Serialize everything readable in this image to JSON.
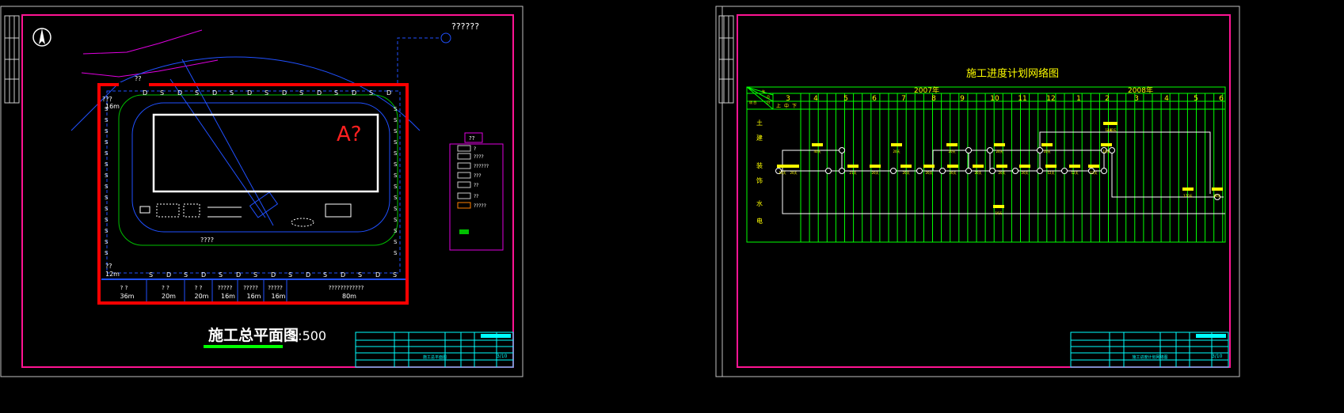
{
  "colors": {
    "background": "#000000",
    "sheet_border": "#c0c0c0",
    "frame": "#ff1493",
    "site_boundary": "#ff0000",
    "grid": "#00ff00",
    "label": "#ffff00",
    "water": "#0040ff",
    "title_block": "#00ffff"
  },
  "left_sheet": {
    "title": "施工总平面图",
    "scale": "1:500",
    "building_label": "A?",
    "top_right_label": "??????",
    "top_label": "??",
    "left_labels": [
      "???",
      "16m",
      "??",
      "12m"
    ],
    "bottom_rooms": [
      {
        "name": "?  ?",
        "size": "36m"
      },
      {
        "name": "?  ?",
        "size": "20m"
      },
      {
        "name": "?  ?",
        "size": "20m"
      },
      {
        "name": "?????",
        "size": "16m"
      },
      {
        "name": "?????",
        "size": "16m"
      },
      {
        "name": "?????",
        "size": "16m"
      },
      {
        "name": "????????????",
        "size": "80m"
      }
    ],
    "road_label": "????",
    "legend": {
      "title": "??",
      "items": [
        "?",
        "????",
        "??????",
        "???",
        "??",
        "??",
        "?????"
      ]
    },
    "title_block": {
      "sheet": "3/10",
      "drawing_name": "施工总平面图"
    }
  },
  "right_sheet": {
    "title": "施工进度计划网络图",
    "years": [
      "2007年",
      "2008年"
    ],
    "months": [
      "3",
      "4",
      "5",
      "6",
      "7",
      "8",
      "9",
      "10",
      "11",
      "12",
      "1",
      "2",
      "3",
      "4",
      "5",
      "6"
    ],
    "header_corner": [
      "年",
      "月",
      "日",
      "项 目"
    ],
    "sub_periods": [
      "上",
      "中",
      "下"
    ],
    "rows": [
      "土",
      "建",
      "装",
      "饰",
      "水",
      "电"
    ],
    "durations": [
      "10天",
      "20天",
      "40天",
      "21天",
      "20天",
      "20天",
      "20天",
      "20天",
      "20天",
      "20天",
      "20天",
      "20天",
      "20天",
      "20天",
      "10天",
      "12天",
      "12天",
      "12天",
      "12天",
      "10天",
      "170天",
      "60天",
      "10天",
      "440天"
    ],
    "title_block": {
      "sheet": "3/10",
      "drawing_name": "施工进度计划网络图"
    }
  }
}
